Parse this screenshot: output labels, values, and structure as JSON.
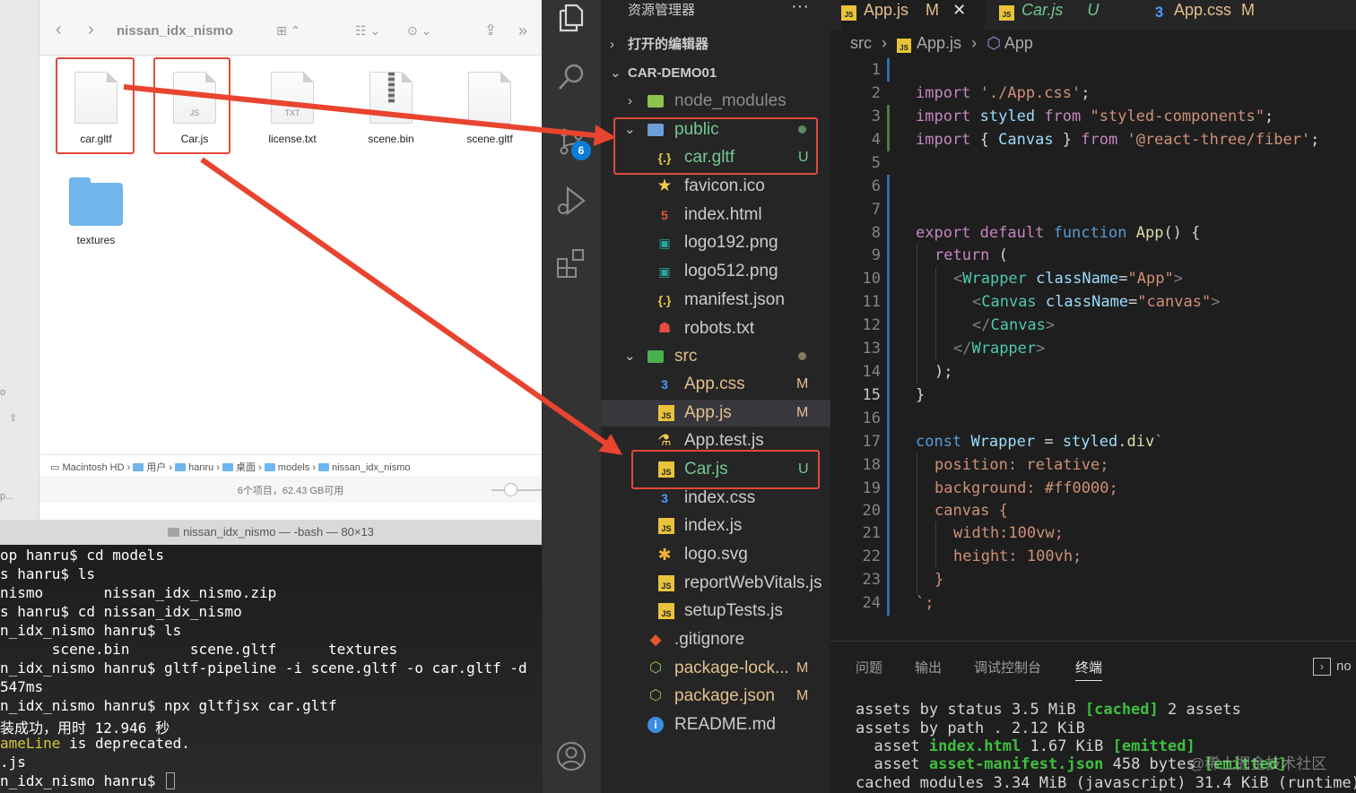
{
  "finder": {
    "title": "nissan_idx_nismo",
    "nav_back": "‹",
    "nav_forward": "›",
    "view_icon": "⊞ ⌃",
    "group_icon": "☷ ⌄",
    "action_icon": "⊙ ⌄",
    "more": "»",
    "sidebar_fragments": [
      "o",
      "⇪",
      "p..."
    ],
    "files": [
      {
        "name": "car.gltf",
        "tag": ""
      },
      {
        "name": "Car.js",
        "tag": "JS"
      },
      {
        "name": "license.txt",
        "tag": "TXT"
      },
      {
        "name": "scene.bin",
        "tag": ""
      },
      {
        "name": "scene.gltf",
        "tag": ""
      },
      {
        "name": "textures",
        "tag": ""
      }
    ],
    "path": [
      "Macintosh HD",
      "用户",
      "hanru",
      "桌面",
      "models",
      "nissan_idx_nismo"
    ],
    "status": "6个项目，62.43 GB可用"
  },
  "terminal": {
    "title": "nissan_idx_nismo — -bash — 80×13",
    "lines": [
      "op hanru$ cd models",
      "s hanru$ ls",
      "nismo       nissan_idx_nismo.zip",
      "s hanru$ cd nissan_idx_nismo",
      "n_idx_nismo hanru$ ls",
      "      scene.bin       scene.gltf      textures",
      "n_idx_nismo hanru$ gltf-pipeline -i scene.gltf -o car.gltf -d",
      "547ms",
      "n_idx_nismo hanru$ npx gltfjsx car.gltf",
      "装成功，用时 12.946 秒",
      " is deprecated.",
      ".js",
      "n_idx_nismo hanru$ "
    ],
    "highlight_fragment": "ameLine"
  },
  "activity": {
    "badge": "6",
    "icons": [
      "explorer-icon",
      "search-icon",
      "source-control-icon",
      "run-debug-icon",
      "extensions-icon",
      "account-icon"
    ]
  },
  "explorer": {
    "header": "资源管理器",
    "more": "···",
    "open_editors": "打开的编辑器",
    "project": "CAR-DEMO01",
    "items": [
      {
        "name": "node_modules",
        "status": ""
      },
      {
        "name": "public",
        "status": ""
      },
      {
        "name": "car.gltf",
        "status": "U"
      },
      {
        "name": "favicon.ico",
        "status": ""
      },
      {
        "name": "index.html",
        "status": ""
      },
      {
        "name": "logo192.png",
        "status": ""
      },
      {
        "name": "logo512.png",
        "status": ""
      },
      {
        "name": "manifest.json",
        "status": ""
      },
      {
        "name": "robots.txt",
        "status": ""
      },
      {
        "name": "src",
        "status": ""
      },
      {
        "name": "App.css",
        "status": "M"
      },
      {
        "name": "App.js",
        "status": "M"
      },
      {
        "name": "App.test.js",
        "status": ""
      },
      {
        "name": "Car.js",
        "status": "U"
      },
      {
        "name": "index.css",
        "status": ""
      },
      {
        "name": "index.js",
        "status": ""
      },
      {
        "name": "logo.svg",
        "status": ""
      },
      {
        "name": "reportWebVitals.js",
        "status": ""
      },
      {
        "name": "setupTests.js",
        "status": ""
      },
      {
        "name": ".gitignore",
        "status": ""
      },
      {
        "name": "package-lock...",
        "status": "M"
      },
      {
        "name": "package.json",
        "status": "M"
      },
      {
        "name": "README.md",
        "status": ""
      }
    ]
  },
  "editor": {
    "tabs": [
      {
        "name": "App.js",
        "status": "M",
        "close": "✕"
      },
      {
        "name": "Car.js",
        "status": "U"
      },
      {
        "name": "App.css",
        "status": "M"
      }
    ],
    "breadcrumb": {
      "src": "src",
      "sep": "›",
      "file": "App.js",
      "symbol": "App"
    },
    "line_numbers": [
      "1",
      "2",
      "3",
      "4",
      "5",
      "6",
      "7",
      "8",
      "9",
      "10",
      "11",
      "12",
      "13",
      "14",
      "15",
      "16",
      "17",
      "18",
      "19",
      "20",
      "21",
      "22",
      "23",
      "24"
    ],
    "code": {
      "l2": [
        "import",
        " './App.css'",
        ";"
      ],
      "l3": [
        "import",
        " styled ",
        "from",
        " \"styled-components\"",
        ";"
      ],
      "l4": [
        "import",
        " { ",
        "Canvas",
        " } ",
        "from",
        " '@react-three/fiber'",
        ";"
      ],
      "l8": [
        "export",
        " ",
        "default",
        " ",
        "function",
        " ",
        "App",
        "() {"
      ],
      "l9": [
        "return",
        " ("
      ],
      "l10": [
        "<",
        "Wrapper",
        " ",
        "className",
        "=",
        "\"App\"",
        ">"
      ],
      "l11": [
        "<",
        "Canvas",
        " ",
        "className",
        "=",
        "\"canvas\"",
        ">"
      ],
      "l12": [
        "</",
        "Canvas",
        ">"
      ],
      "l13": [
        "</",
        "Wrapper",
        ">"
      ],
      "l14": ");",
      "l15": "}",
      "l17": [
        "const",
        " ",
        "Wrapper",
        " = ",
        "styled",
        ".",
        "div",
        "`"
      ],
      "l18": "position: relative;",
      "l19": "background: #ff0000;",
      "l20": "canvas {",
      "l21": "width:100vw;",
      "l22": "height: 100vh;",
      "l23": "}",
      "l24": "`;"
    }
  },
  "panel": {
    "tabs": [
      "问题",
      "输出",
      "调试控制台",
      "终端"
    ],
    "terminal_picker": "no",
    "lines": [
      {
        "a": "assets by status 3.5 MiB ",
        "b": "[cached]",
        "c": " 2 assets"
      },
      {
        "a": "assets by path . 2.12 KiB",
        "b": "",
        "c": ""
      },
      {
        "a": "  asset ",
        "b": "index.html",
        "c": " 1.67 KiB ",
        "d": "[emitted]"
      },
      {
        "a": "  asset ",
        "b": "asset-manifest.json",
        "c": " 458 bytes ",
        "d": "[emitted]"
      },
      {
        "a": "cached modules 3.34 MiB (javascript) 31.4 KiB (runtime)",
        "b": "",
        "c": ""
      }
    ],
    "watermark": "@稀土掘金技术社区"
  }
}
